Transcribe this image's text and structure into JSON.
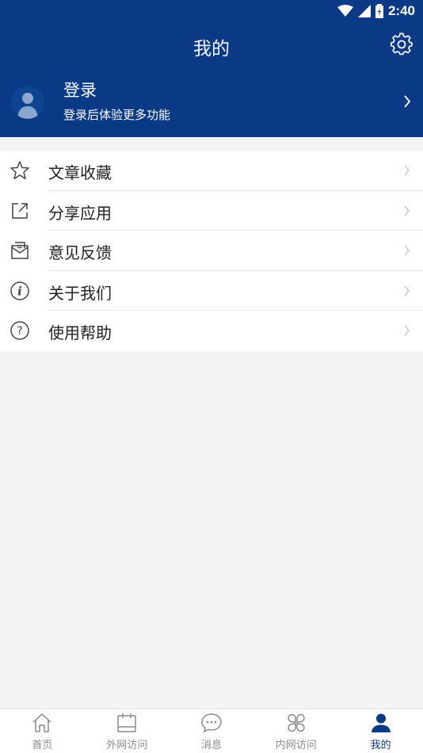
{
  "status_bar": {
    "time": "2:40"
  },
  "header": {
    "title": "我的"
  },
  "profile": {
    "name": "登录",
    "subtitle": "登录后体验更多功能"
  },
  "menu": [
    {
      "label": "文章收藏",
      "icon": "star-icon"
    },
    {
      "label": "分享应用",
      "icon": "share-icon"
    },
    {
      "label": "意见反馈",
      "icon": "feedback-icon"
    },
    {
      "label": "关于我们",
      "icon": "info-icon"
    },
    {
      "label": "使用帮助",
      "icon": "help-icon"
    }
  ],
  "tabs": [
    {
      "label": "首页",
      "icon": "home-icon",
      "active": false
    },
    {
      "label": "外网访问",
      "icon": "calendar-icon",
      "active": false
    },
    {
      "label": "消息",
      "icon": "message-icon",
      "active": false
    },
    {
      "label": "内网访问",
      "icon": "apps-icon",
      "active": false
    },
    {
      "label": "我的",
      "icon": "user-icon",
      "active": true
    }
  ],
  "colors": {
    "primary": "#0a3a86",
    "background": "#f3f3f3",
    "inactive": "#8a8a8a"
  }
}
